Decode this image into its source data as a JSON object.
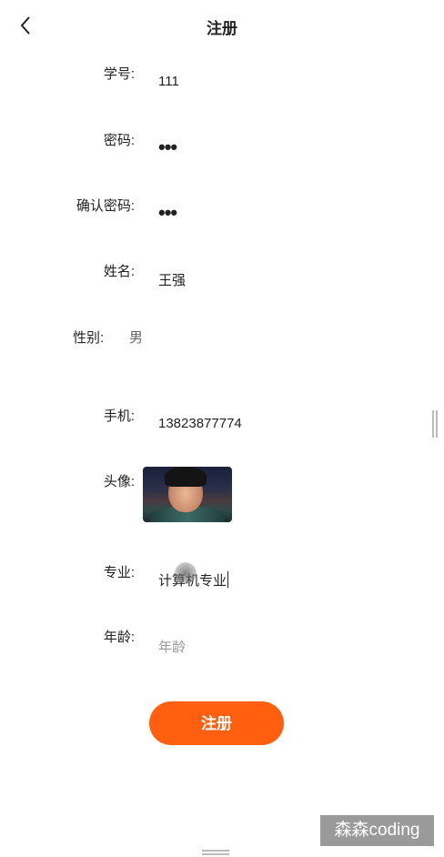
{
  "header": {
    "title": "注册"
  },
  "form": {
    "student_id": {
      "label": "学号:",
      "value": "111"
    },
    "password": {
      "label": "密码:",
      "value": "•••"
    },
    "confirm_password": {
      "label": "确认密码:",
      "value": "•••"
    },
    "name": {
      "label": "姓名:",
      "value": "王强"
    },
    "gender": {
      "label": "性别:",
      "value": "男"
    },
    "phone": {
      "label": "手机:",
      "value": "13823877774"
    },
    "avatar": {
      "label": "头像:"
    },
    "major": {
      "label": "专业:",
      "value": "计算机专业"
    },
    "age": {
      "label": "年龄:",
      "placeholder": "年龄"
    }
  },
  "submit_label": "注册",
  "watermark": "森森coding",
  "colors": {
    "accent": "#ff5f0f",
    "text": "#222222",
    "placeholder": "#999999"
  }
}
